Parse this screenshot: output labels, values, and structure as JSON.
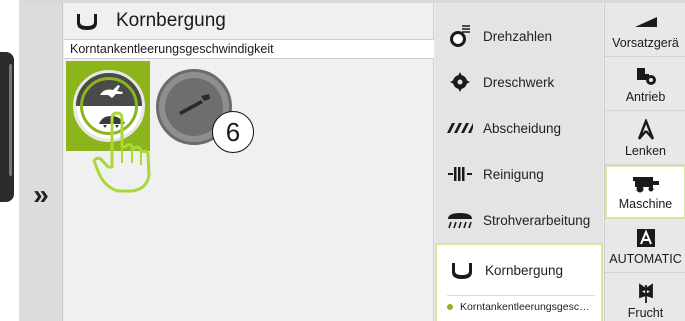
{
  "left_strip": {
    "expand_label": "»"
  },
  "main": {
    "title": "Kornbergung",
    "subtitle": "Korntankentleerungsgeschwindigkeit",
    "callout_number": "6"
  },
  "menu": {
    "items": [
      {
        "label": "Drehzahlen",
        "icon": "rpm-icon"
      },
      {
        "label": "Dreschwerk",
        "icon": "threshing-icon"
      },
      {
        "label": "Abscheidung",
        "icon": "separation-icon"
      },
      {
        "label": "Reinigung",
        "icon": "cleaning-icon"
      },
      {
        "label": "Strohverarbeitung",
        "icon": "straw-icon"
      },
      {
        "label": "Kornbergung",
        "icon": "grain-tank-icon",
        "sub": "Korntankentleerungsgesc…"
      }
    ]
  },
  "right_tabs": {
    "items": [
      {
        "label": "Vorsatzgerä",
        "icon": "header-icon"
      },
      {
        "label": "Antrieb",
        "icon": "drive-icon"
      },
      {
        "label": "Lenken",
        "icon": "steering-icon"
      },
      {
        "label": "Maschine",
        "icon": "combine-icon"
      },
      {
        "label": "AUTOMATIC",
        "icon": "automatic-icon"
      },
      {
        "label": "Frucht",
        "icon": "crop-icon"
      }
    ]
  },
  "colors": {
    "accent": "#8cb51c",
    "active_border": "#d6e6a7"
  }
}
